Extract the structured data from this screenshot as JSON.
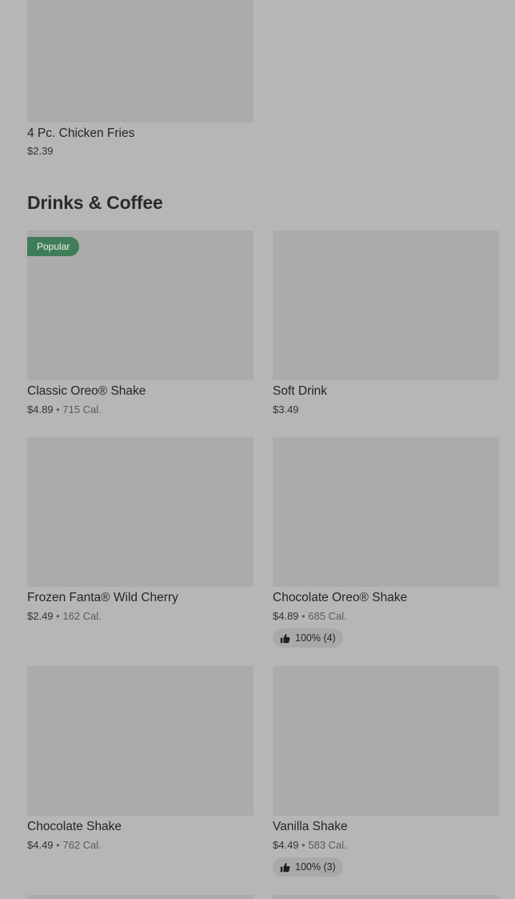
{
  "top_item": {
    "name": "4 Pc. Chicken Fries",
    "price": "$2.39"
  },
  "section": {
    "title": "Drinks & Coffee"
  },
  "items": [
    {
      "name": "Classic Oreo® Shake",
      "price": "$4.89",
      "sep": "•",
      "calories": "715 Cal.",
      "badge": "Popular"
    },
    {
      "name": "Soft Drink",
      "price": "$3.49"
    },
    {
      "name": "Frozen Fanta® Wild Cherry",
      "price": "$2.49",
      "sep": "•",
      "calories": "162 Cal."
    },
    {
      "name": "Chocolate Oreo® Shake",
      "price": "$4.89",
      "sep": "•",
      "calories": "685 Cal.",
      "rating": "100% (4)",
      "rating_icon": "thumbs-up-icon"
    },
    {
      "name": "Chocolate Shake",
      "price": "$4.49",
      "sep": "•",
      "calories": "762 Cal."
    },
    {
      "name": "Vanilla Shake",
      "price": "$4.49",
      "sep": "•",
      "calories": "583 Cal.",
      "rating": "100% (3)",
      "rating_icon": "thumbs-up-icon"
    }
  ]
}
